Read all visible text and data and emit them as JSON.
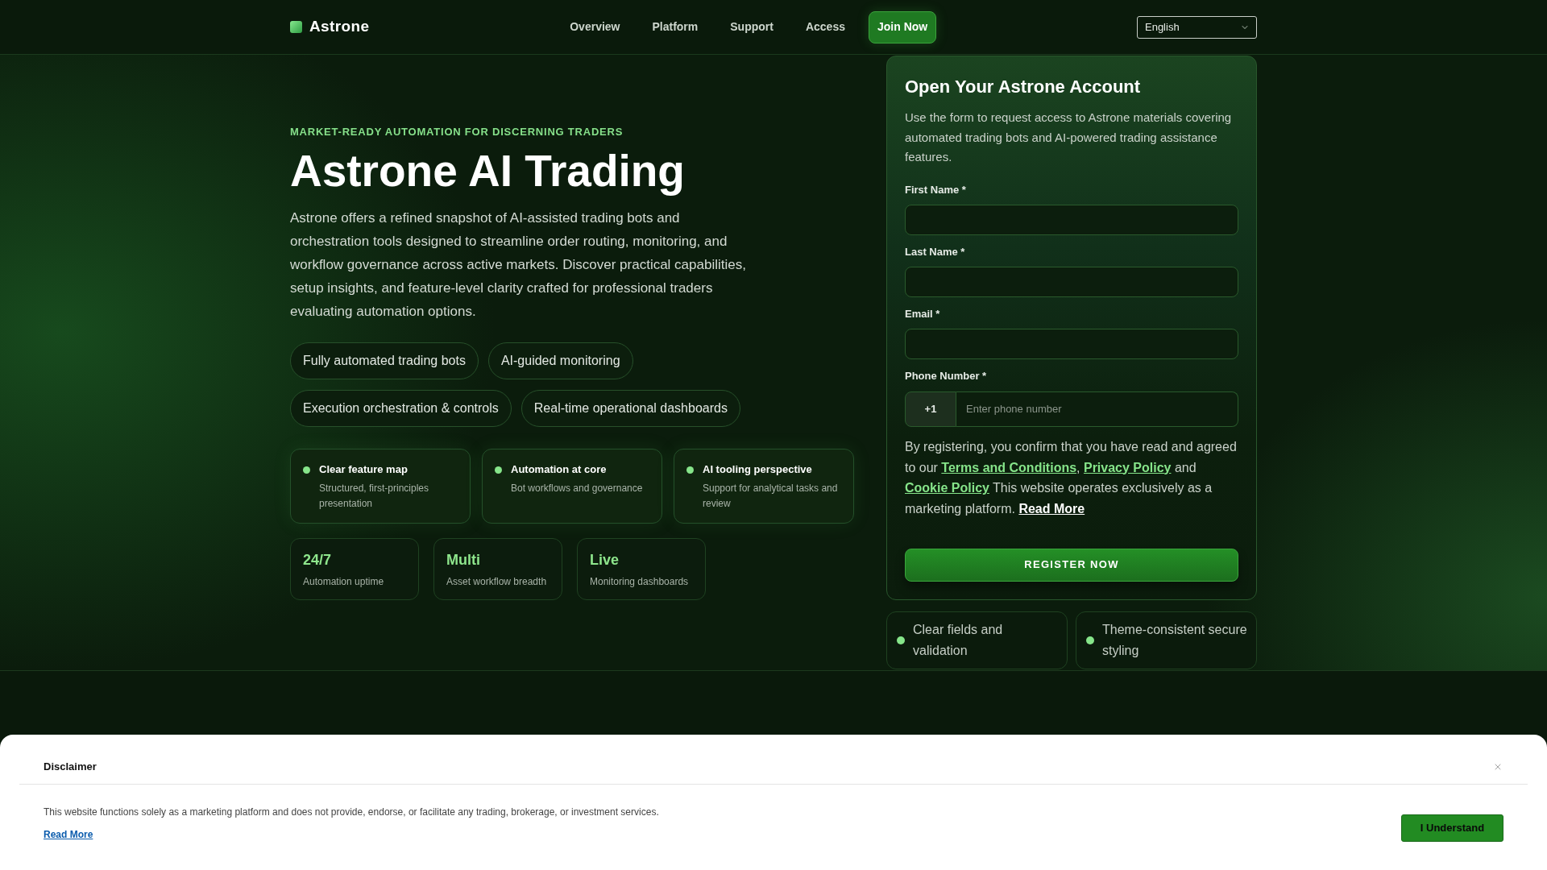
{
  "header": {
    "brand": "Astrone",
    "nav": [
      "Overview",
      "Platform",
      "Support",
      "Access"
    ],
    "cta": "Join Now",
    "language": {
      "value": "English"
    }
  },
  "hero": {
    "eyebrow": "MARKET-READY AUTOMATION FOR DISCERNING TRADERS",
    "title": "Astrone AI Trading",
    "description": "Astrone offers a refined snapshot of AI-assisted trading bots and orchestration tools designed to streamline order routing, monitoring, and workflow governance across active markets. Discover practical capabilities, setup insights, and feature-level clarity crafted for professional traders evaluating automation options.",
    "tags": [
      "Fully automated trading bots",
      "AI-guided monitoring",
      "Execution orchestration & controls",
      "Real-time operational dashboards"
    ],
    "features": [
      {
        "title": "Clear feature map",
        "description": "Structured, first-principles presentation"
      },
      {
        "title": "Automation at core",
        "description": "Bot workflows and governance"
      },
      {
        "title": "AI tooling perspective",
        "description": "Support for analytical tasks and review"
      }
    ],
    "stats": [
      {
        "value": "24/7",
        "label": "Automation uptime"
      },
      {
        "value": "Multi",
        "label": "Asset workflow breadth"
      },
      {
        "value": "Live",
        "label": "Monitoring dashboards"
      }
    ]
  },
  "form": {
    "title": "Open Your Astrone Account",
    "description": "Use the form to request access to Astrone materials covering automated trading bots and AI-powered trading assistance features.",
    "fields": [
      {
        "kind": "text",
        "label": "First Name *"
      },
      {
        "kind": "text",
        "label": "Last Name *"
      },
      {
        "kind": "email",
        "label": "Email *"
      },
      {
        "kind": "phone",
        "label": "Phone Number *",
        "prefix": "+1",
        "placeholder": "Enter phone number"
      }
    ],
    "consent": [
      {
        "kind": "text",
        "text": "By registering, you confirm that you have read and agreed to our "
      },
      {
        "kind": "link",
        "text": "Terms and Conditions"
      },
      {
        "kind": "text",
        "text": ", "
      },
      {
        "kind": "link",
        "text": "Privacy Policy"
      },
      {
        "kind": "text",
        "text": " and "
      },
      {
        "kind": "link",
        "text": "Cookie Policy"
      },
      {
        "kind": "text",
        "text": " This website operates exclusively as a marketing platform. "
      },
      {
        "kind": "more",
        "text": "Read More"
      }
    ],
    "submit": "REGISTER NOW"
  },
  "highlights": [
    "Clear fields and validation",
    "Theme-consistent secure styling"
  ],
  "disclaimer": {
    "title": "Disclaimer",
    "text": "This website functions solely as a marketing platform and does not provide, endorse, or facilitate any trading, brokerage, or investment services.",
    "link": "Read More",
    "button": "I Understand"
  }
}
